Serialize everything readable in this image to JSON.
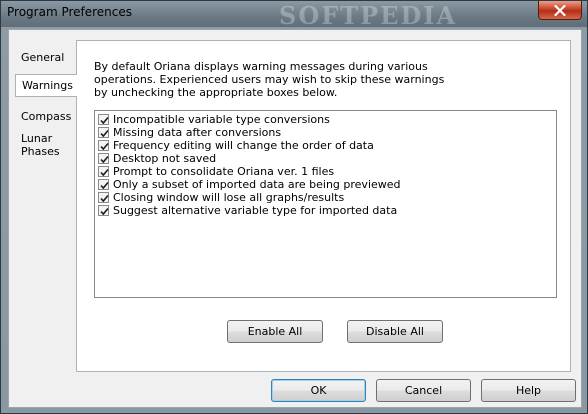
{
  "window": {
    "title": "Program Preferences",
    "watermark": "SOFTPEDIA"
  },
  "tabs": [
    {
      "label": "General"
    },
    {
      "label": "Warnings"
    },
    {
      "label": "Compass"
    },
    {
      "label": "Lunar Phases"
    }
  ],
  "warnings": {
    "description": "By default Oriana displays warning messages during various operations. Experienced users may wish to skip these warnings by unchecking the appropriate boxes below.",
    "items": [
      {
        "label": "Incompatible variable type conversions",
        "checked": true
      },
      {
        "label": "Missing data after conversions",
        "checked": true
      },
      {
        "label": "Frequency editing will change the order of data",
        "checked": true
      },
      {
        "label": "Desktop not saved",
        "checked": true
      },
      {
        "label": "Prompt to consolidate Oriana ver. 1 files",
        "checked": true
      },
      {
        "label": "Only a subset of imported data are being previewed",
        "checked": true
      },
      {
        "label": "Closing window will lose all graphs/results",
        "checked": true
      },
      {
        "label": "Suggest alternative variable type for imported data",
        "checked": true
      }
    ],
    "enable_all_label": "Enable All",
    "disable_all_label": "Disable All"
  },
  "footer": {
    "ok_label": "OK",
    "cancel_label": "Cancel",
    "help_label": "Help"
  }
}
